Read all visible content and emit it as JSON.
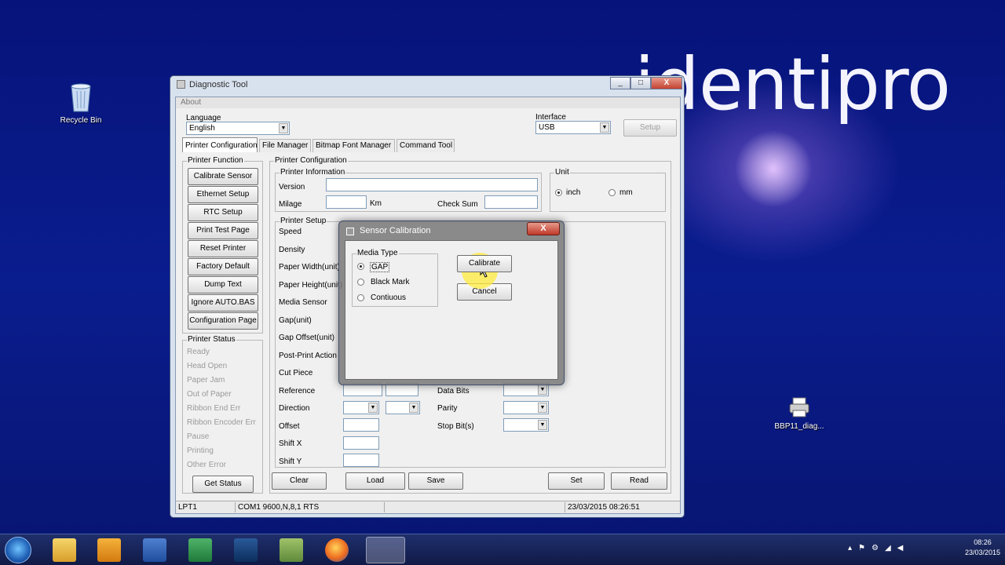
{
  "desktop": {
    "brand": "identipro",
    "icons": [
      {
        "label": "Recycle Bin"
      },
      {
        "label": "BBP11_diag..."
      }
    ]
  },
  "window": {
    "title": "Diagnostic Tool",
    "controls": {
      "minimize": "_",
      "maximize": "□",
      "close": "X"
    },
    "menu": {
      "about": "About"
    },
    "language": {
      "label": "Language",
      "value": "English"
    },
    "interface": {
      "label": "Interface",
      "value": "USB",
      "setup": "Setup"
    },
    "tabs": [
      "Printer Configuration",
      "File Manager",
      "Bitmap Font Manager",
      "Command Tool"
    ],
    "printer_function": {
      "title": "Printer Function",
      "buttons": [
        "Calibrate Sensor",
        "Ethernet Setup",
        "RTC Setup",
        "Print Test Page",
        "Reset Printer",
        "Factory Default",
        "Dump Text",
        "Ignore AUTO.BAS",
        "Configuration Page"
      ]
    },
    "printer_status": {
      "title": "Printer Status",
      "items": [
        "Ready",
        "Head Open",
        "Paper Jam",
        "Out of Paper",
        "Ribbon End Err",
        "Ribbon Encoder Err",
        "Pause",
        "Printing",
        "Other Error"
      ],
      "get_status": "Get Status"
    },
    "printer_config": {
      "title": "Printer Configuration",
      "info": {
        "title": "Printer Information",
        "version": "Version",
        "milage": "Milage",
        "km": "Km",
        "check_sum": "Check Sum"
      },
      "unit": {
        "title": "Unit",
        "inch": "inch",
        "mm": "mm",
        "selected": "inch"
      },
      "setup": {
        "title": "Printer Setup",
        "fields": [
          "Speed",
          "Density",
          "Paper Width(unit)",
          "Paper Height(unit)",
          "Media Sensor",
          "Gap(unit)",
          "Gap Offset(unit)",
          "Post-Print Action",
          "Cut Piece",
          "Reference",
          "Direction",
          "Offset",
          "Shift X",
          "Shift Y"
        ],
        "serial": [
          "Data Bits",
          "Parity",
          "Stop Bit(s)"
        ]
      },
      "buttons": {
        "clear": "Clear",
        "load": "Load",
        "save": "Save",
        "set": "Set",
        "read": "Read"
      }
    },
    "statusbar": {
      "port": "LPT1",
      "com": "COM1 9600,N,8,1 RTS",
      "datetime": "23/03/2015 08:26:51"
    }
  },
  "dialog": {
    "title": "Sensor Calibration",
    "close": "X",
    "media_type": {
      "title": "Media Type",
      "options": [
        "GAP",
        "Black Mark",
        "Contiuous"
      ],
      "selected": "GAP"
    },
    "calibrate": "Calibrate",
    "cancel": "Cancel"
  },
  "taskbar": {
    "apps": [
      "explorer",
      "outlook",
      "word",
      "excel",
      "photoshop",
      "messenger",
      "firefox",
      "diagnostic-tool"
    ],
    "time": "08:26",
    "date": "23/03/2015"
  }
}
